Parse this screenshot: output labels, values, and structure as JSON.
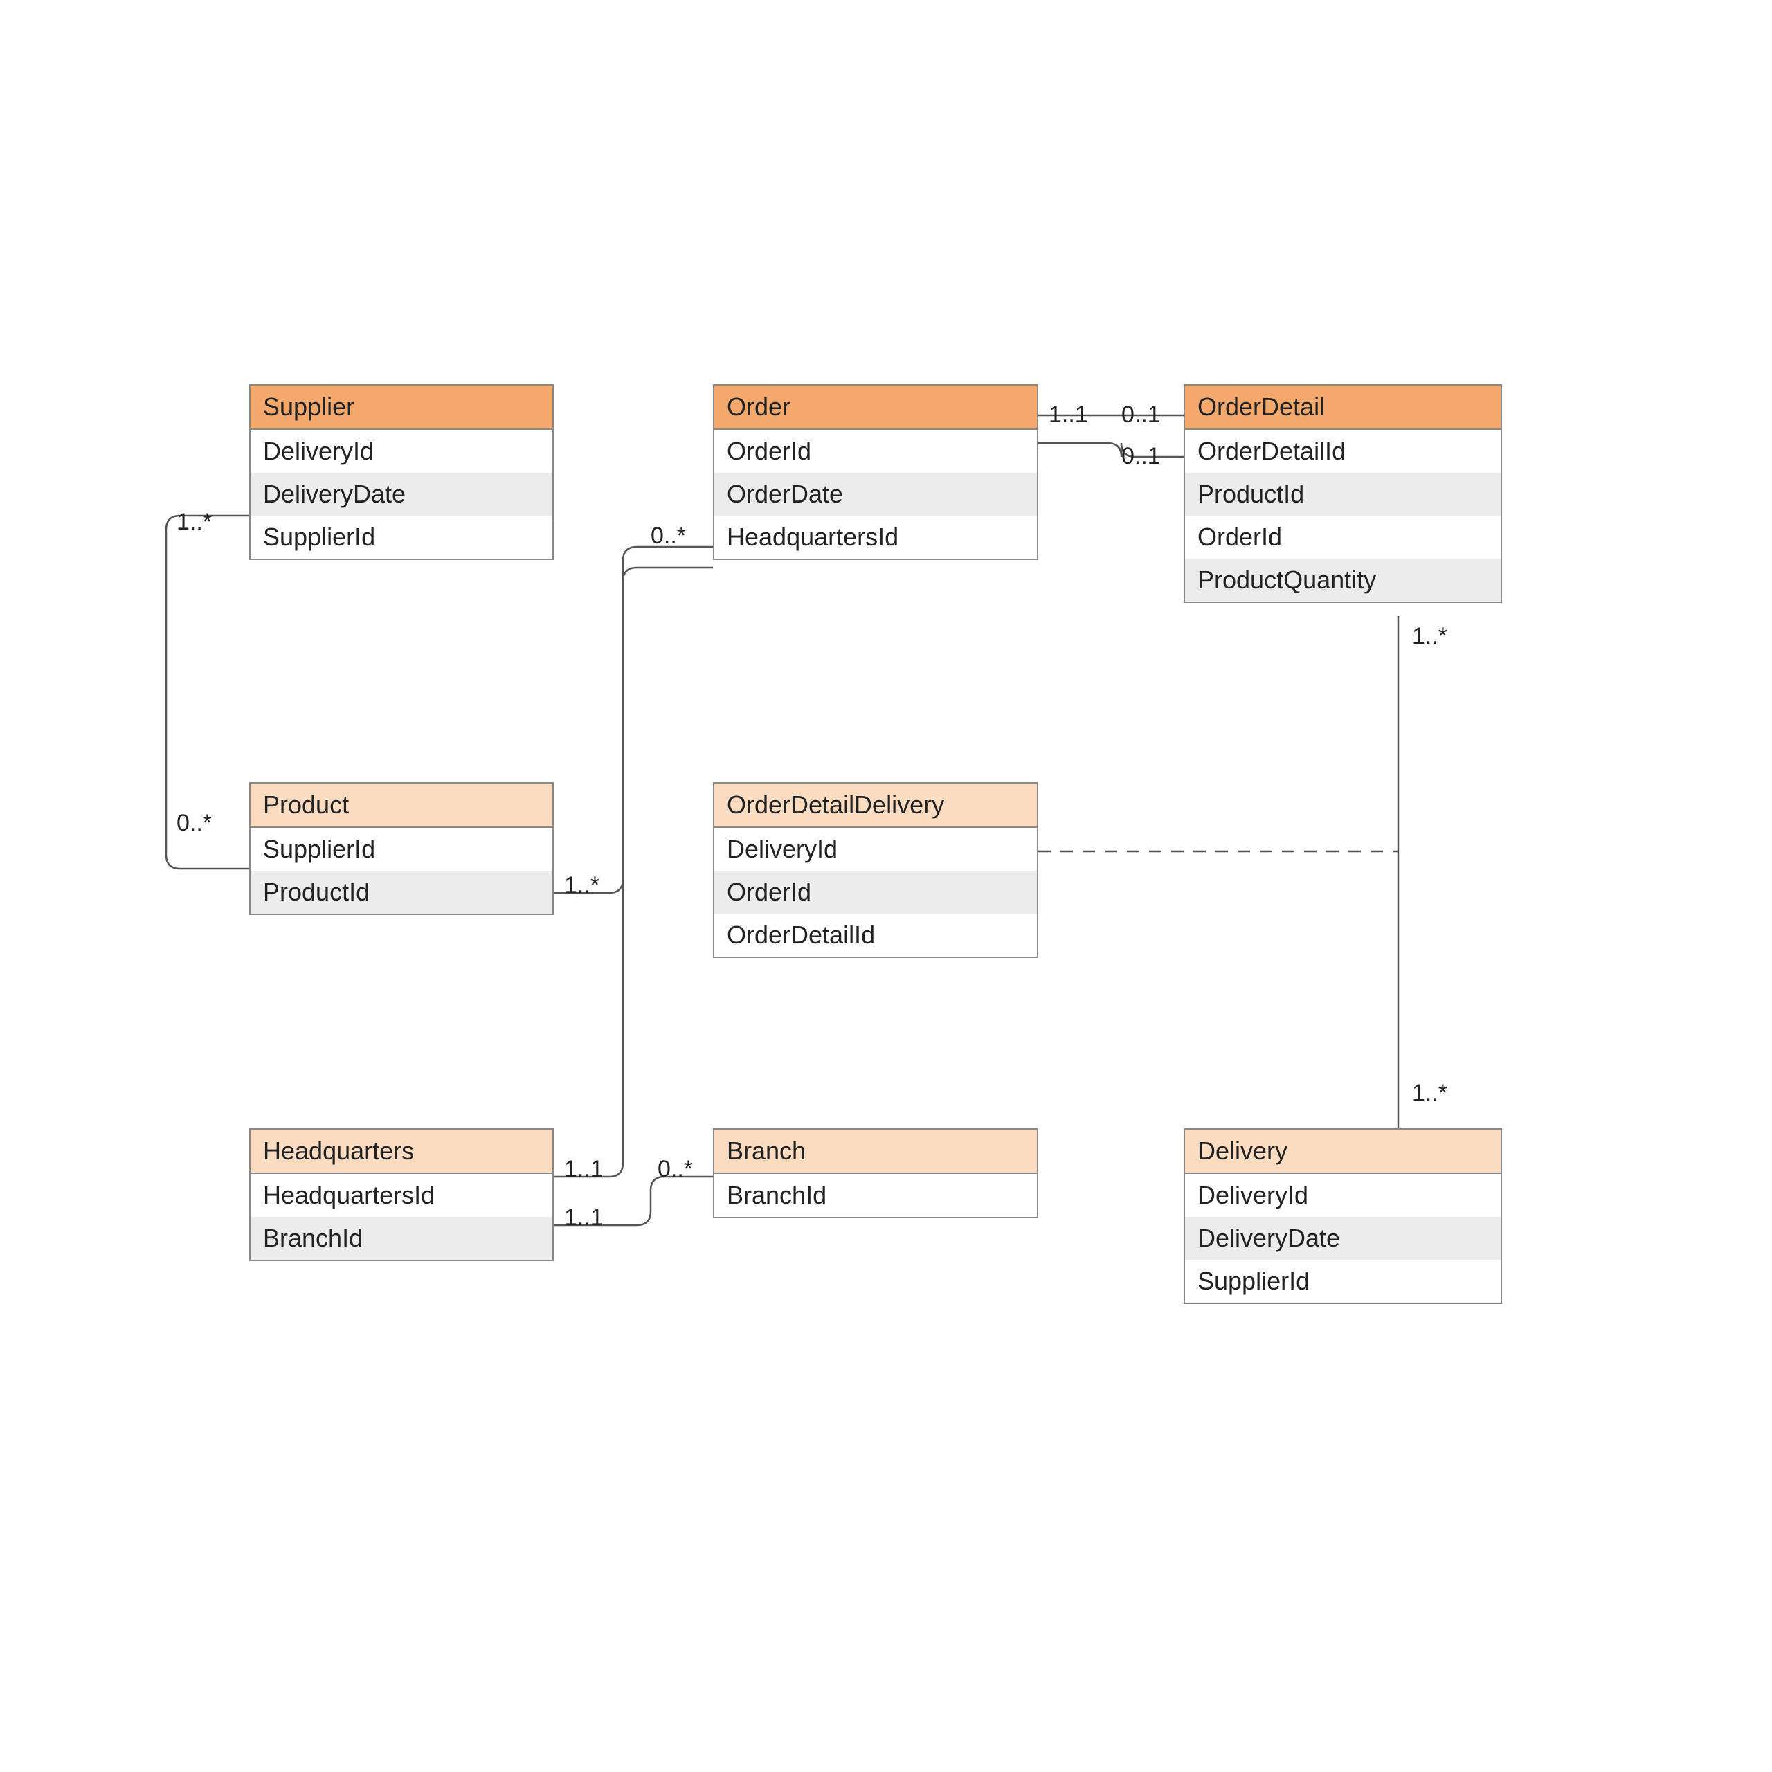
{
  "entities": {
    "supplier": {
      "title": "Supplier",
      "rows": [
        "DeliveryId",
        "DeliveryDate",
        "SupplierId"
      ],
      "header": "dark"
    },
    "order": {
      "title": "Order",
      "rows": [
        "OrderId",
        "OrderDate",
        "HeadquartersId"
      ],
      "header": "dark"
    },
    "orderDetail": {
      "title": "OrderDetail",
      "rows": [
        "OrderDetailId",
        "ProductId",
        "OrderId",
        "ProductQuantity"
      ],
      "header": "dark"
    },
    "product": {
      "title": "Product",
      "rows": [
        "SupplierId",
        "ProductId"
      ],
      "header": "light"
    },
    "orderDetailDelivery": {
      "title": "OrderDetailDelivery",
      "rows": [
        "DeliveryId",
        "OrderId",
        "OrderDetailId"
      ],
      "header": "light"
    },
    "headquarters": {
      "title": "Headquarters",
      "rows": [
        "HeadquartersId",
        "BranchId"
      ],
      "header": "light"
    },
    "branch": {
      "title": "Branch",
      "rows": [
        "BranchId"
      ],
      "header": "light"
    },
    "delivery": {
      "title": "Delivery",
      "rows": [
        "DeliveryId",
        "DeliveryDate",
        "SupplierId"
      ],
      "header": "light"
    }
  },
  "multiplicities": {
    "supplier_left_top": "1..*",
    "supplier_left_bottom": "0..*",
    "order_left": "0..*",
    "order_right": "1..1",
    "orderDetail_left_top": "0..1",
    "orderDetail_left_bottom": "0..1",
    "orderDetail_below": "1..*",
    "product_right": "1..*",
    "headquarters_right_top": "1..1",
    "headquarters_right_bottom": "1..1",
    "branch_left": "0..*",
    "delivery_top": "1..*"
  }
}
